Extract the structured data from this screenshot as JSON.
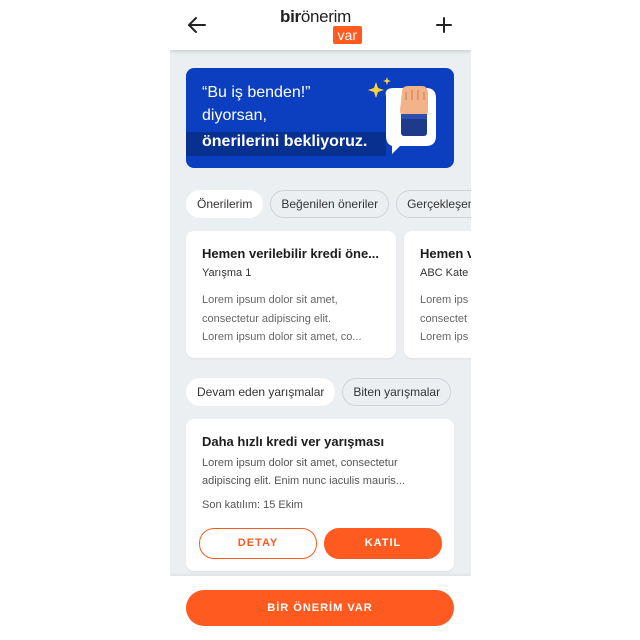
{
  "header": {
    "logo_bir": "bir",
    "logo_onerim": "önerim",
    "logo_var": "var"
  },
  "banner": {
    "line1": "“Bu iş benden!”",
    "line2": "diyorsan,",
    "line3": "önerilerini bekliyoruz."
  },
  "idea_tabs": [
    {
      "label": "Önerilerim",
      "active": true
    },
    {
      "label": "Beğenilen öneriler",
      "active": false
    },
    {
      "label": "Gerçekleşen",
      "active": false
    }
  ],
  "idea_cards": [
    {
      "title": "Hemen verilebilir kredi öne...",
      "subtitle": "Yarışma 1",
      "body": [
        "Lorem ipsum dolor sit amet,",
        "consectetur adipiscing elit.",
        "Lorem ipsum dolor sit amet, co..."
      ]
    },
    {
      "title": "Hemen v",
      "subtitle": "ABC Kate",
      "body": [
        "Lorem ips",
        "consectet",
        "Lorem ips"
      ]
    }
  ],
  "contest_tabs": [
    {
      "label": "Devam eden yarışmalar",
      "active": true
    },
    {
      "label": "Biten yarışmalar",
      "active": false
    }
  ],
  "contest_card": {
    "title": "Daha hızlı kredi ver yarışması",
    "body": [
      "Lorem ipsum dolor sit amet, consectetur",
      "adipiscing elit. Enim nunc iaculis mauris..."
    ],
    "deadline": "Son katılım: 15 Ekim",
    "detail_label": "DETAY",
    "join_label": "KATIL"
  },
  "cta_label": "BİR ÖNERİM VAR",
  "colors": {
    "accent": "#ff5a1f",
    "banner": "#0b3fc0",
    "background": "#eceff2"
  }
}
